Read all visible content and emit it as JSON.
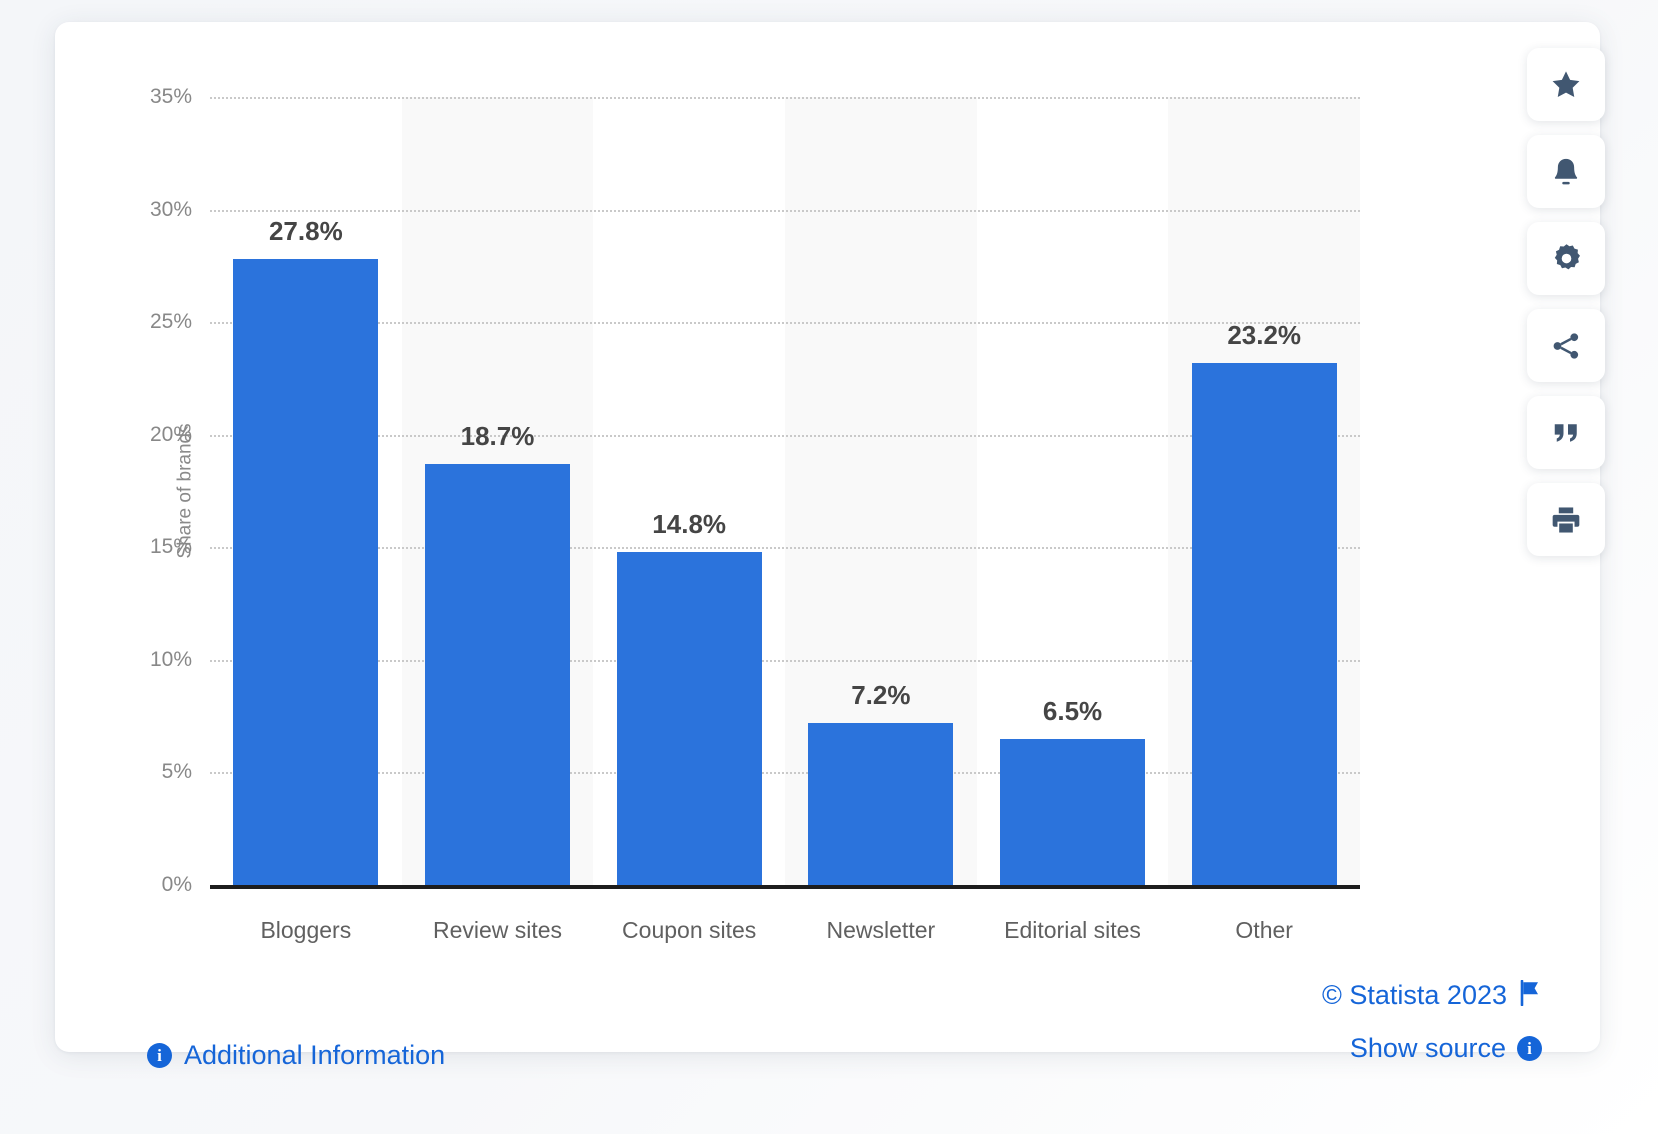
{
  "chart_data": {
    "type": "bar",
    "title": "",
    "xlabel": "",
    "ylabel": "Share of brands",
    "ylim": [
      0,
      35
    ],
    "grid": true,
    "legend": false,
    "value_suffix": "%",
    "categories": [
      "Bloggers",
      "Review sites",
      "Coupon sites",
      "Newsletter",
      "Editorial sites",
      "Other"
    ],
    "values": [
      27.8,
      18.7,
      14.8,
      7.2,
      6.5,
      23.2
    ],
    "value_labels": [
      "27.8%",
      "18.7%",
      "14.8%",
      "7.2%",
      "6.5%",
      "23.2%"
    ],
    "yticks": [
      0,
      5,
      10,
      15,
      20,
      25,
      30,
      35
    ],
    "ytick_labels": [
      "0%",
      "5%",
      "10%",
      "15%",
      "20%",
      "25%",
      "30%",
      "35%"
    ],
    "bar_color": "#2b73dc",
    "band_color": "#f9f9f9",
    "gridline_color": "#c9c9c9",
    "axis_color": "#1d1d1d"
  },
  "toolbar": {
    "items": [
      {
        "name": "favorite",
        "icon": "star-icon"
      },
      {
        "name": "alert",
        "icon": "bell-icon"
      },
      {
        "name": "settings",
        "icon": "gear-icon"
      },
      {
        "name": "share",
        "icon": "share-icon"
      },
      {
        "name": "cite",
        "icon": "quote-icon"
      },
      {
        "name": "print",
        "icon": "printer-icon"
      }
    ],
    "icon_color": "#415771"
  },
  "footer": {
    "additional_information": "Additional Information",
    "copyright": "© Statista 2023",
    "show_source": "Show source",
    "info_glyph": "i",
    "link_color": "#1565d8"
  }
}
